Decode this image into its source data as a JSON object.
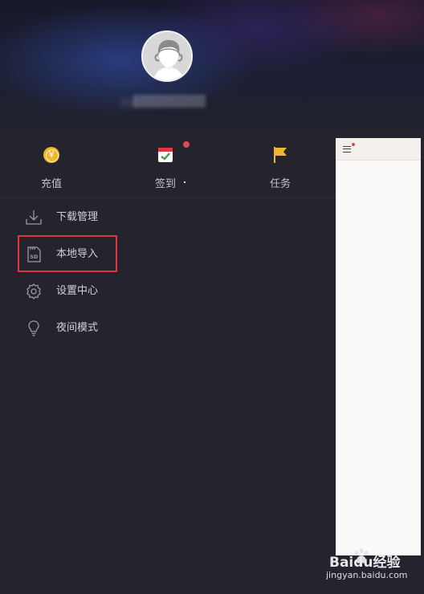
{
  "quick_actions": [
    {
      "label": "充值",
      "icon": "yuan-coin-icon",
      "color": "#f0b62c"
    },
    {
      "label": "签到",
      "icon": "calendar-check-icon",
      "color": "#43a047",
      "has_badge": true
    },
    {
      "label": "任务",
      "icon": "flag-icon",
      "color": "#f0b62c"
    }
  ],
  "coin_symbol": "¥",
  "menu": [
    {
      "label": "下载管理",
      "icon": "download-icon"
    },
    {
      "label": "本地导入",
      "icon": "sd-card-icon",
      "icon_text": "SD",
      "highlighted": true
    },
    {
      "label": "设置中心",
      "icon": "gear-icon"
    },
    {
      "label": "夜间模式",
      "icon": "lightbulb-icon"
    }
  ],
  "colors": {
    "drawer_bg": "#25242e",
    "badge": "#e24a55",
    "highlight": "#e0373f"
  },
  "watermark": {
    "brand": "Baidu经验",
    "url": "jingyan.baidu.com"
  }
}
